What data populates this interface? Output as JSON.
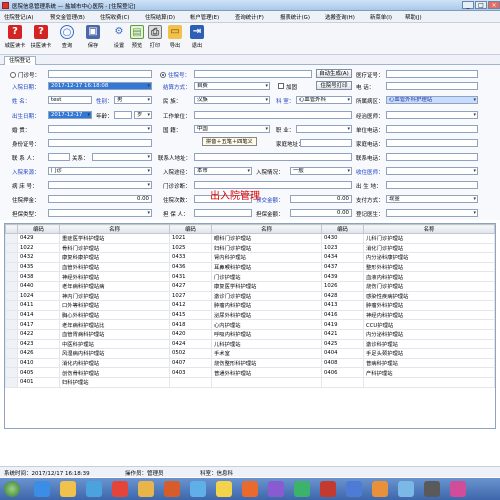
{
  "window": {
    "title": "医院信息管理系统 — 盐城市中心医院 - [住院登记]",
    "controls": [
      "_",
      "□",
      "×"
    ]
  },
  "menu": [
    "住院登记(A)",
    "预交金管理(B)",
    "住院收费(C)",
    "住院结算(D)",
    "帐户管理(E)",
    "查询统计(F)",
    "报表统计(G)",
    "选搬查询(H)",
    "新菜单(I)",
    "帮助(J)"
  ],
  "toolbar": [
    {
      "label": "城医读卡",
      "icon": "question-card-icon",
      "color": "#d42323"
    },
    {
      "label": "扶医读卡",
      "icon": "question-card-icon",
      "color": "#d42323"
    },
    {
      "label": "查询",
      "icon": "search-icon",
      "color": "#3a6fc4"
    },
    {
      "label": "保存",
      "icon": "save-icon",
      "color": "#4b68a8"
    },
    {
      "label": "设置",
      "icon": "gear-icon",
      "color": "#3a6fc4"
    },
    {
      "label": "预览",
      "icon": "preview-icon",
      "color": "#5a9e3a"
    },
    {
      "label": "打印",
      "icon": "print-icon",
      "color": "#555"
    },
    {
      "label": "导出",
      "icon": "export-icon",
      "color": "#d89b1e"
    },
    {
      "label": "退出",
      "icon": "exit-icon",
      "color": "#2c5fb5"
    }
  ],
  "tab": "住院登记",
  "form": {
    "menzhen_label": "门诊号：",
    "zhuyuan_label": "住院号：",
    "auto_gen_button": "自动生成(A)",
    "yibaozheng_label": "医疗证号：",
    "ruyuan_date_label": "入院日期：",
    "ruyuan_date": "2017-12-17 16:18:08",
    "jiesuan_label": "结算方式：",
    "jiesuan_value": "自费",
    "jiaji_label": "加固",
    "print_button": "住院号打印",
    "dianhua_label": "电 话：",
    "name_label": "姓   名：",
    "name_value": "test",
    "sex_label": "性别：",
    "sex_value": "男",
    "minzu_label": "民    族：",
    "minzu_value": "汉族",
    "keshi_label": "科   室：",
    "keshi_value": "心血管外科",
    "bingqu_label": "所属病区：",
    "bingqu_value": "心血管外科护理站",
    "birth_label": "出生日期：",
    "birth_value": "2017-12-17",
    "age_label": "年龄：",
    "age_unit": "岁",
    "gongzuo_label": "工作单位：",
    "yisheng_label": "经治医师：",
    "hunyin_label": "婚    贯：",
    "guoji_label": "国    籍：",
    "guoji_value": "中国",
    "zhiye_label": "职    业：",
    "danweidh_label": "单位电话：",
    "shenfen_label": "身份证号：",
    "jiating_label": "家庭地址：",
    "jiatingdh_label": "家庭电话：",
    "lianxi_label": "联 系 人：",
    "guanxi_label": "关系：",
    "lianxidz_label": "联系人地址：",
    "lianxidh_label": "联系电话：",
    "laiyuan_label": "入院来源：",
    "laiyuan_value": "门诊",
    "tujing_label": "入院途径：",
    "tujing_value": "本市",
    "qingkuang_label": "入院情况：",
    "qingkuang_value": "一般",
    "shoushu_label": "收住医师：",
    "bingqing_label": "病 床 号：",
    "menzhen_zd_label": "门诊诊断：",
    "chusheng_label": "出 生 地：",
    "yajin_label": "住院押金：",
    "yajin_value": "0.00",
    "cishu_label": "住院次数：",
    "jine_label": "预交金额：",
    "jine_value": "0.00",
    "zhifu_label": "支付方式：",
    "zhifu_value": "现金",
    "danbao_label": "担保类型：",
    "danbaoren_label": "担 保 人：",
    "danbaojine_label": "担保金额：",
    "danbaojine_value": "0.00",
    "dengji_label": "登记医生："
  },
  "tooltip": "拼音＋五笔＋四笔义",
  "big_title": "出入院管理",
  "grid": {
    "headers": [
      "编码",
      "名称",
      "编码",
      "名称",
      "编码",
      "名称"
    ],
    "rows": [
      [
        "0429",
        "重症医学科护理站",
        "1021",
        "眼科门诊护理站",
        "0430",
        "儿科门诊护理站"
      ],
      [
        "1022",
        "骨科门诊护理站",
        "1025",
        "妇科门诊护理站",
        "1023",
        "消化门诊护理站"
      ],
      [
        "0432",
        "康复科康护理站",
        "0433",
        "肾内科护理站",
        "0434",
        "内分泌科康护理站"
      ],
      [
        "0435",
        "血管外科护理站",
        "0436",
        "耳鼻喉科护理站",
        "0437",
        "整形外科护理站"
      ],
      [
        "0438",
        "神经外科护理站",
        "0431",
        "门诊护理站",
        "0439",
        "血液内科护理站"
      ],
      [
        "0440",
        "老年病科护理站病",
        "0427",
        "康复医学科护理站",
        "1026",
        "烧伤门诊护理站"
      ],
      [
        "1024",
        "神内门诊护理站",
        "1027",
        "激诊门诊护理站",
        "0428",
        "感染性疾病护理站"
      ],
      [
        "0411",
        "口外等科护理站",
        "0412",
        "肿瘤内科护理站",
        "0413",
        "肿瘤外科护理站"
      ],
      [
        "0414",
        "胸心外科护理站",
        "0415",
        "泌尿外科护理站",
        "0416",
        "神经内科护理站"
      ],
      [
        "0417",
        "老年病科护理站比",
        "0418",
        "心内护理站",
        "0419",
        "CCU护理站"
      ],
      [
        "0422",
        "血管胃病科护理站",
        "0420",
        "呼吸内科护理站",
        "0421",
        "内分泌科护理站"
      ],
      [
        "0423",
        "中医科护理站",
        "0424",
        "儿科护理站",
        "0425",
        "激诊科护理站"
      ],
      [
        "0426",
        "风湿病内科护理站",
        "0502",
        "手术室",
        "0404",
        "手足头颈护理站"
      ],
      [
        "0410",
        "消化内科护理站",
        "0407",
        "烧伤整形科护理站",
        "0408",
        "普病科护理站"
      ],
      [
        "0405",
        "创伤骨科护理站",
        "0403",
        "普通外科护理站",
        "0406",
        "产科护理站"
      ],
      [
        "0401",
        "妇科护理站",
        "",
        "",
        "",
        ""
      ]
    ]
  },
  "status": {
    "time_label": "系统时间：2017/12/17 16:18:39",
    "user_label": "操作员：管理员",
    "dept_label": "科室：信息科"
  },
  "taskbar_icons": [
    "start-orb-icon",
    "ie-icon",
    "folder-icon",
    "media-icon",
    "chrome-icon",
    "app-icon",
    "app-icon",
    "app-icon",
    "app-icon",
    "app-icon",
    "app-icon",
    "app-icon",
    "app-icon",
    "app-icon",
    "app-icon",
    "app-icon",
    "app-icon",
    "app-icon"
  ]
}
